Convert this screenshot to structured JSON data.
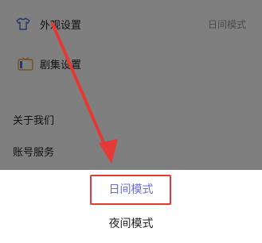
{
  "settings": {
    "appearance": {
      "label": "外观设置",
      "value": "日间模式",
      "icon": "tshirt-icon"
    },
    "episodes": {
      "label": "剧集设置",
      "icon": "tv-icon"
    },
    "about": {
      "label": "关于我们"
    },
    "account": {
      "label": "账号服务"
    }
  },
  "sheet": {
    "options": [
      {
        "label": "日间模式",
        "selected": true
      },
      {
        "label": "夜间模式",
        "selected": false
      }
    ]
  },
  "annotation": {
    "color": "#e53935",
    "selected_color": "#6b6fd1"
  }
}
